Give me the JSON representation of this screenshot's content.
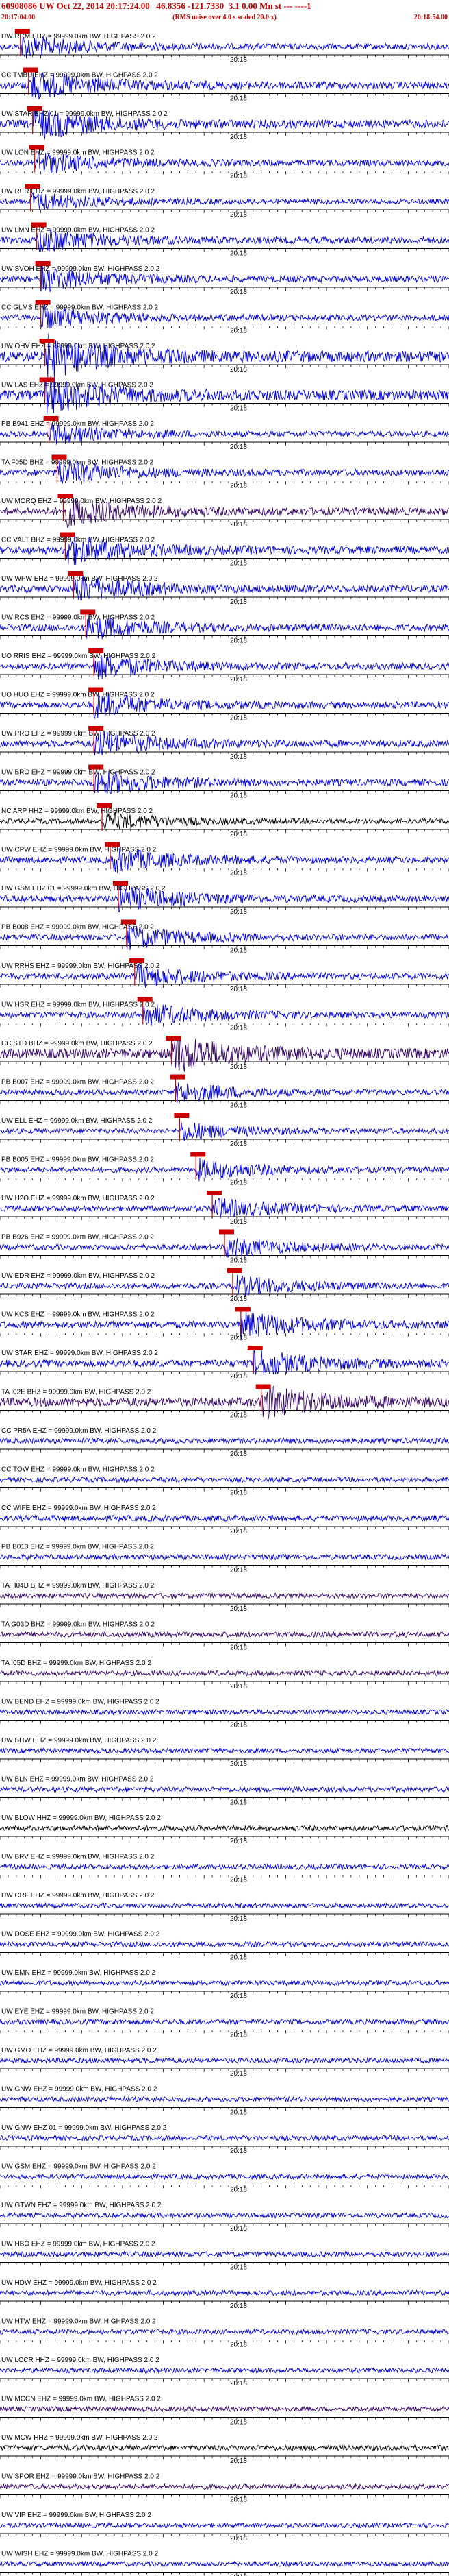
{
  "header": {
    "title": "60908086 UW Oct 22, 2014 20:17:24.00   46.8356 -121.7330  3.1 0.00 Mn st --- ----1",
    "start_time": "20:17:04.00",
    "end_time": "20:18:54.00",
    "rms_note": "(RMS noise over 4.0 s scaled 20.0 x)"
  },
  "chart_data": {
    "type": "line",
    "title": "60908086 UW Oct 22, 2014 20:17:24.00   46.8356 -121.7330  3.1 0.00 Mn st --- ----1",
    "x_start": "20:17:04.00",
    "x_end": "20:18:54.00",
    "x_range_seconds": [
      0,
      110
    ],
    "tick_label": "20:18",
    "tick_at_seconds": 56,
    "filter_suffix": "= 99999.0km BW, HIGHPASS  2.0  2",
    "colors": {
      "blue": "#0000dd",
      "purple": "#330066",
      "black": "#000000",
      "pick": "#cc0000"
    },
    "series": [
      {
        "name": "UW RCM EHZ",
        "color": "blue",
        "pick": 5.0,
        "amp": 0.55
      },
      {
        "name": "CC TMBU EHZ",
        "color": "blue",
        "pick": 7.0,
        "amp": 0.7
      },
      {
        "name": "UW STAR EHZ 01",
        "color": "blue",
        "pick": 8.0,
        "amp": 0.75
      },
      {
        "name": "UW LON EHZ",
        "color": "blue",
        "pick": 8.5,
        "amp": 0.55
      },
      {
        "name": "UW RER EHZ",
        "color": "blue",
        "pick": 7.5,
        "amp": 0.45
      },
      {
        "name": "UW LMN EHZ",
        "color": "blue",
        "pick": 9.0,
        "amp": 0.6
      },
      {
        "name": "UW SVOH EHZ",
        "color": "blue",
        "pick": 10.0,
        "amp": 0.6
      },
      {
        "name": "CC GLMS EHZ",
        "color": "blue",
        "pick": 10.0,
        "amp": 0.55
      },
      {
        "name": "UW OHV EHZ",
        "color": "blue",
        "pick": 11.0,
        "amp": 1.0
      },
      {
        "name": "UW LAS EHZ",
        "color": "blue",
        "pick": 11.0,
        "amp": 0.9
      },
      {
        "name": "PB B941 EHZ",
        "color": "blue",
        "pick": 12.0,
        "amp": 0.5
      },
      {
        "name": "TA F05D BHZ",
        "color": "blue",
        "pick": 14.0,
        "amp": 0.6
      },
      {
        "name": "UW MORQ EHZ",
        "color": "purple",
        "pick": 15.5,
        "amp": 0.7
      },
      {
        "name": "CC VALT BHZ",
        "color": "blue",
        "pick": 16.0,
        "amp": 0.7
      },
      {
        "name": "UW WPW EHZ",
        "color": "blue",
        "pick": 18.0,
        "amp": 0.65
      },
      {
        "name": "UW RCS EHZ",
        "color": "blue",
        "pick": 21.0,
        "amp": 0.6
      },
      {
        "name": "UO RRIS EHZ",
        "color": "blue",
        "pick": 23.0,
        "amp": 0.6
      },
      {
        "name": "UO HUO EHZ",
        "color": "blue",
        "pick": 23.0,
        "amp": 0.6
      },
      {
        "name": "UW PRO EHZ",
        "color": "blue",
        "pick": 23.0,
        "amp": 0.6
      },
      {
        "name": "UW BRO EHZ",
        "color": "blue",
        "pick": 23.0,
        "amp": 0.6
      },
      {
        "name": "NC ARP HHZ",
        "color": "black",
        "pick": 25.0,
        "amp": 0.45
      },
      {
        "name": "UW CPW EHZ",
        "color": "blue",
        "pick": 27.0,
        "amp": 0.6
      },
      {
        "name": "UW GSM EHZ 01",
        "color": "blue",
        "pick": 29.0,
        "amp": 0.6
      },
      {
        "name": "PB B008 EHZ",
        "color": "blue",
        "pick": 31.0,
        "amp": 0.55
      },
      {
        "name": "UW RRHS EHZ",
        "color": "blue",
        "pick": 33.0,
        "amp": 0.55
      },
      {
        "name": "UW HSR EHZ",
        "color": "blue",
        "pick": 35.0,
        "amp": 0.55
      },
      {
        "name": "CC STD BHZ",
        "color": "purple",
        "pick": 42.0,
        "amp": 0.9
      },
      {
        "name": "PB B007 EHZ",
        "color": "blue",
        "pick": 43.0,
        "amp": 0.5
      },
      {
        "name": "UW ELL EHZ",
        "color": "blue",
        "pick": 44.0,
        "amp": 0.45
      },
      {
        "name": "PB B005 EHZ",
        "color": "blue",
        "pick": 48.0,
        "amp": 0.5
      },
      {
        "name": "UW H2O EHZ",
        "color": "blue",
        "pick": 52.0,
        "amp": 0.5
      },
      {
        "name": "PB B926 EHZ",
        "color": "blue",
        "pick": 55.0,
        "amp": 0.5
      },
      {
        "name": "UW EDR EHZ",
        "color": "blue",
        "pick": 57.0,
        "amp": 0.5
      },
      {
        "name": "UW KCS EHZ",
        "color": "blue",
        "pick": 59.0,
        "amp": 0.65
      },
      {
        "name": "UW STAR EHZ",
        "color": "blue",
        "pick": 62.0,
        "amp": 0.65
      },
      {
        "name": "TA I02E BHZ",
        "color": "purple",
        "pick": 64.0,
        "amp": 0.8
      },
      {
        "name": "CC PR5A EHZ",
        "color": "blue",
        "pick": null,
        "amp": 0.45
      },
      {
        "name": "CC TOW EHZ",
        "color": "blue",
        "pick": null,
        "amp": 0.45
      },
      {
        "name": "CC WIFE EHZ",
        "color": "blue",
        "pick": null,
        "amp": 0.55
      },
      {
        "name": "PB B013 EHZ",
        "color": "blue",
        "pick": null,
        "amp": 0.5
      },
      {
        "name": "TA H04D BHZ",
        "color": "purple",
        "pick": null,
        "amp": 0.45
      },
      {
        "name": "TA G03D BHZ",
        "color": "purple",
        "pick": null,
        "amp": 0.45
      },
      {
        "name": "TA I05D BHZ",
        "color": "purple",
        "pick": null,
        "amp": 0.45
      },
      {
        "name": "UW BEND EHZ",
        "color": "blue",
        "pick": null,
        "amp": 0.45
      },
      {
        "name": "UW BHW EHZ",
        "color": "blue",
        "pick": null,
        "amp": 0.45
      },
      {
        "name": "UW BLN EHZ",
        "color": "blue",
        "pick": null,
        "amp": 0.45
      },
      {
        "name": "UW BLOW HHZ",
        "color": "black",
        "pick": null,
        "amp": 0.45
      },
      {
        "name": "UW BRV EHZ",
        "color": "blue",
        "pick": null,
        "amp": 0.45
      },
      {
        "name": "UW CRF EHZ",
        "color": "blue",
        "pick": null,
        "amp": 0.45
      },
      {
        "name": "UW DOSE EHZ",
        "color": "blue",
        "pick": null,
        "amp": 0.45
      },
      {
        "name": "UW EMN EHZ",
        "color": "blue",
        "pick": null,
        "amp": 0.45
      },
      {
        "name": "UW EYE EHZ",
        "color": "blue",
        "pick": null,
        "amp": 0.45
      },
      {
        "name": "UW GMO EHZ",
        "color": "blue",
        "pick": null,
        "amp": 0.45
      },
      {
        "name": "UW GNW EHZ",
        "color": "blue",
        "pick": null,
        "amp": 0.45
      },
      {
        "name": "UW GNW EHZ 01",
        "color": "blue",
        "pick": null,
        "amp": 0.45
      },
      {
        "name": "UW GSM EHZ",
        "color": "blue",
        "pick": null,
        "amp": 0.45
      },
      {
        "name": "UW GTWN EHZ",
        "color": "blue",
        "pick": null,
        "amp": 0.45
      },
      {
        "name": "UW HBO EHZ",
        "color": "blue",
        "pick": null,
        "amp": 0.45
      },
      {
        "name": "UW HDW EHZ",
        "color": "blue",
        "pick": null,
        "amp": 0.45
      },
      {
        "name": "UW HTW EHZ",
        "color": "blue",
        "pick": null,
        "amp": 0.45
      },
      {
        "name": "UW LCCR HHZ",
        "color": "blue",
        "pick": null,
        "amp": 0.45
      },
      {
        "name": "UW MCCN EHZ",
        "color": "purple",
        "pick": null,
        "amp": 0.45
      },
      {
        "name": "UW MCW HHZ",
        "color": "black",
        "pick": null,
        "amp": 0.45
      },
      {
        "name": "UW SPOR EHZ",
        "color": "purple",
        "pick": null,
        "amp": 0.45
      },
      {
        "name": "UW VIP EHZ",
        "color": "blue",
        "pick": null,
        "amp": 0.45
      },
      {
        "name": "UW WISH EHZ",
        "color": "blue",
        "pick": null,
        "amp": 0.45
      }
    ]
  }
}
